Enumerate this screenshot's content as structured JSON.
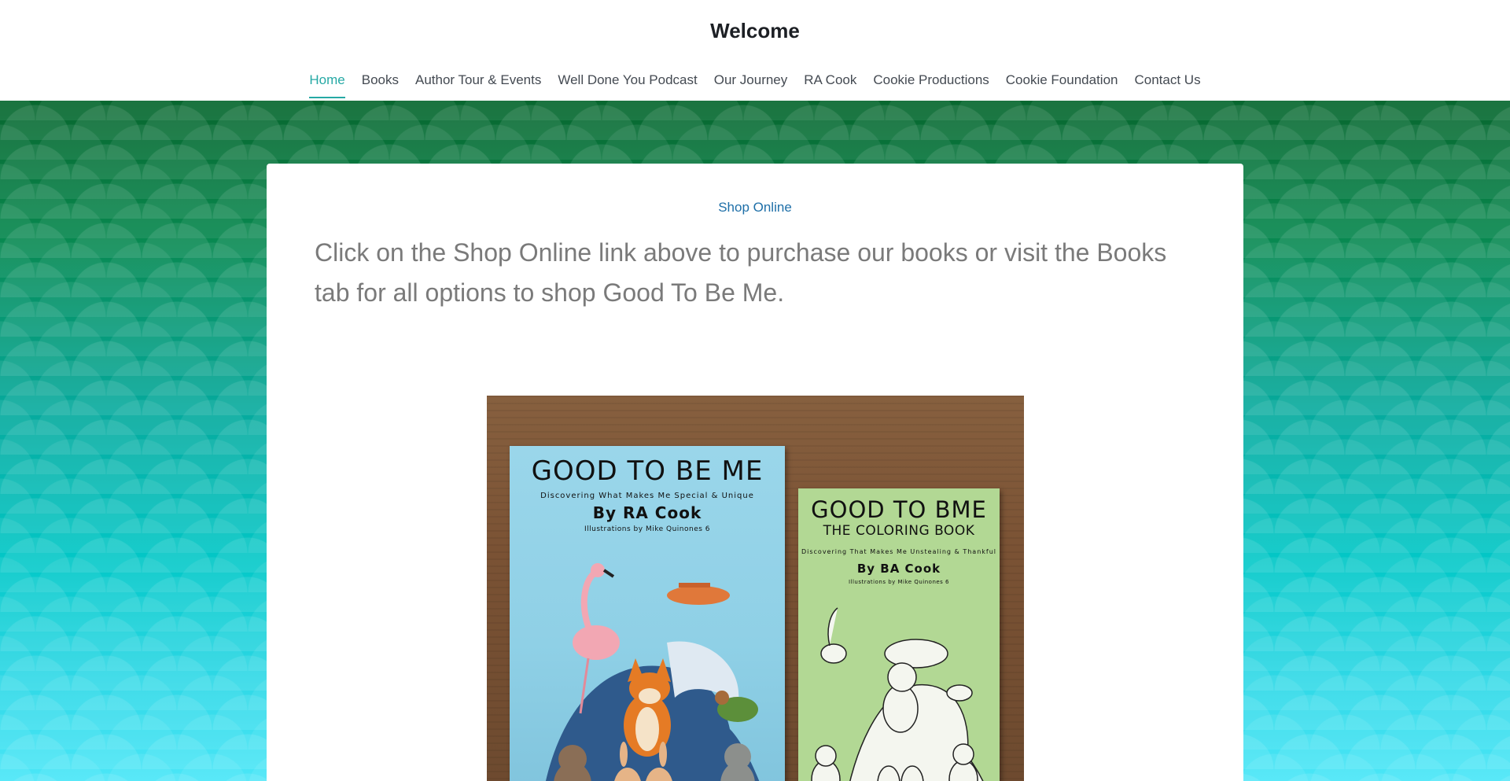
{
  "header": {
    "title": "Welcome"
  },
  "nav": {
    "items": [
      {
        "label": "Home",
        "active": true
      },
      {
        "label": "Books"
      },
      {
        "label": "Author Tour & Events"
      },
      {
        "label": "Well Done You Podcast"
      },
      {
        "label": "Our Journey"
      },
      {
        "label": "RA Cook"
      },
      {
        "label": "Cookie Productions"
      },
      {
        "label": "Cookie Foundation"
      },
      {
        "label": "Contact Us"
      }
    ]
  },
  "content": {
    "shop_link": "Shop Online",
    "intro": "Click on the Shop Online link above to purchase our books or visit the Books tab for all options to shop Good To Be Me."
  },
  "books": {
    "main": {
      "title": "GOOD TO BE ME",
      "subtitle": "Discovering What Makes Me Special & Unique",
      "author": "By RA Cook",
      "illustrator": "Illustrations by Mike Quinones 6"
    },
    "coloring": {
      "title": "GOOD TO BME",
      "title2": "THE COLORING BOOK",
      "subtitle": "Discovering That Makes Me Unstealing & Thankful",
      "author": "By BA Cook",
      "illustrator": "Illustrations by Mike Quinones 6"
    }
  },
  "colors": {
    "accent": "#26a9a5",
    "link": "#1e6fa8",
    "hero_top": "#08672f",
    "hero_bottom": "#4be6f7"
  }
}
